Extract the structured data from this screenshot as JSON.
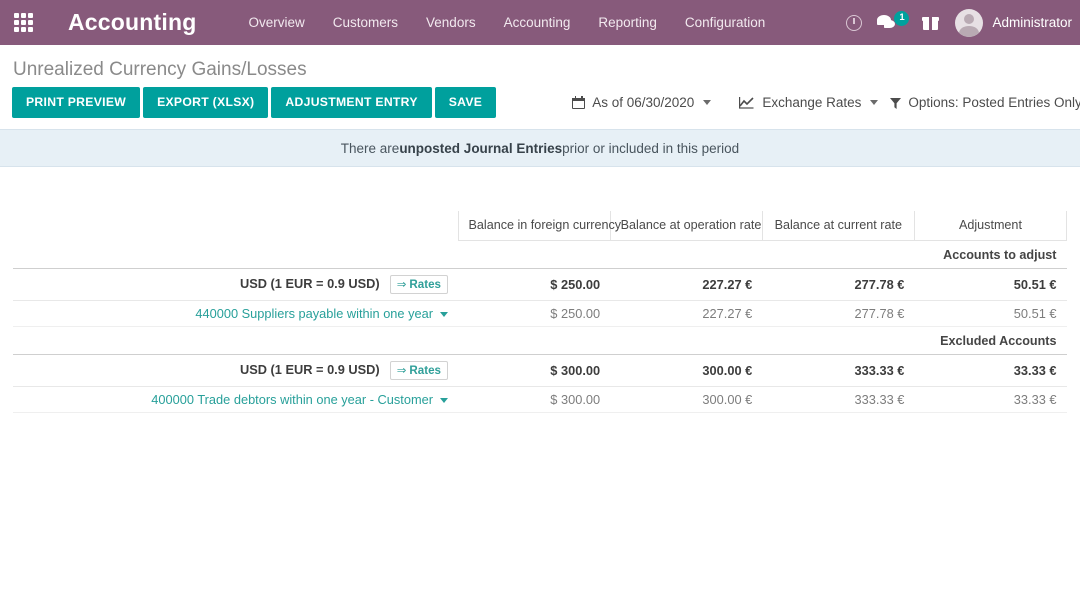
{
  "navbar": {
    "apps_icon": "apps-grid-icon",
    "brand": "Accounting",
    "menu": [
      {
        "label": "Overview"
      },
      {
        "label": "Customers"
      },
      {
        "label": "Vendors"
      },
      {
        "label": "Accounting"
      },
      {
        "label": "Reporting"
      },
      {
        "label": "Configuration"
      }
    ],
    "tray": {
      "activity_icon": "clock-icon",
      "messages_icon": "chat-icon",
      "messages_count": "1",
      "gift_icon": "gift-icon",
      "user_name": "Administrator",
      "avatar_icon": "avatar-icon"
    },
    "brand_color": "#875A7B",
    "badge_color": "#00A09D"
  },
  "control_panel": {
    "title": "Unrealized Currency Gains/Losses",
    "buttons": [
      {
        "label": "PRINT PREVIEW",
        "name": "print-preview-button"
      },
      {
        "label": "EXPORT (XLSX)",
        "name": "export-xlsx-button"
      },
      {
        "label": "ADJUSTMENT ENTRY",
        "name": "adjustment-entry-button"
      },
      {
        "label": "SAVE",
        "name": "save-button"
      }
    ],
    "button_color": "#00A09D",
    "filters": [
      {
        "name": "date-filter",
        "icon": "calendar-icon",
        "label": "As of 06/30/2020"
      },
      {
        "name": "exchange-rates-filter",
        "icon": "line-chart-icon",
        "label": "Exchange Rates"
      },
      {
        "name": "options-filter",
        "icon": "funnel-icon",
        "label": "Options: Posted Entries Only"
      }
    ]
  },
  "banner": {
    "prefix": "There are ",
    "strong": "unposted Journal Entries",
    "suffix": " prior or included in this period",
    "background": "#E7F0F6"
  },
  "report": {
    "columns": [
      {
        "label": ""
      },
      {
        "label": "Balance in foreign currency"
      },
      {
        "label": "Balance at operation rate"
      },
      {
        "label": "Balance at current rate"
      },
      {
        "label": "Adjustment"
      }
    ],
    "sections": [
      {
        "title": "Accounts to adjust",
        "rows": [
          {
            "type": "currency",
            "label": "USD (1 EUR = 0.9 USD)",
            "rates_badge": "Rates",
            "rates_arrow": "⇒",
            "values": [
              "$ 250.00",
              "227.27 €",
              "277.78 €",
              "50.51 €"
            ]
          },
          {
            "type": "account",
            "label": "440000 Suppliers payable within one year",
            "values": [
              "$ 250.00",
              "227.27 €",
              "277.78 €",
              "50.51 €"
            ]
          }
        ]
      },
      {
        "title": "Excluded Accounts",
        "rows": [
          {
            "type": "currency",
            "label": "USD (1 EUR = 0.9 USD)",
            "rates_badge": "Rates",
            "rates_arrow": "⇒",
            "values": [
              "$ 300.00",
              "300.00 €",
              "333.33 €",
              "33.33 €"
            ]
          },
          {
            "type": "account",
            "label": "400000 Trade debtors within one year - Customer",
            "values": [
              "$ 300.00",
              "300.00 €",
              "333.33 €",
              "33.33 €"
            ]
          }
        ]
      }
    ],
    "link_color": "#28a09a"
  }
}
